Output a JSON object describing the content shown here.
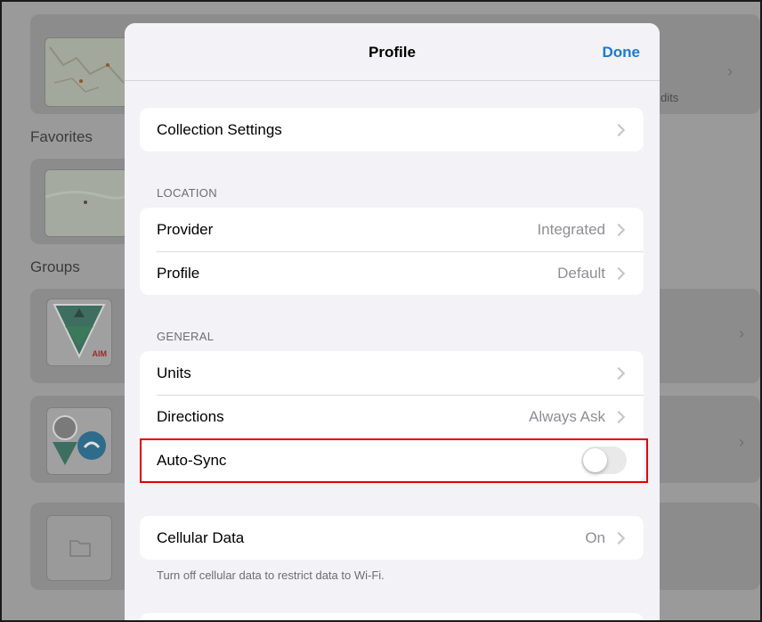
{
  "background": {
    "favorites_label": "Favorites",
    "groups_label": "Groups",
    "partial_text": "dits",
    "aim_badge": "AIM"
  },
  "sheet": {
    "title": "Profile",
    "done_label": "Done",
    "collection_settings": {
      "label": "Collection Settings"
    },
    "location": {
      "header": "LOCATION",
      "provider": {
        "label": "Provider",
        "value": "Integrated"
      },
      "profile": {
        "label": "Profile",
        "value": "Default"
      }
    },
    "general": {
      "header": "GENERAL",
      "units": {
        "label": "Units",
        "value": ""
      },
      "directions": {
        "label": "Directions",
        "value": "Always Ask"
      },
      "auto_sync": {
        "label": "Auto-Sync",
        "enabled": false
      }
    },
    "cellular": {
      "label": "Cellular Data",
      "value": "On",
      "note": "Turn off cellular data to restrict data to Wi-Fi."
    }
  },
  "colors": {
    "accent": "#1b7ad2",
    "highlight": "#e00000"
  }
}
